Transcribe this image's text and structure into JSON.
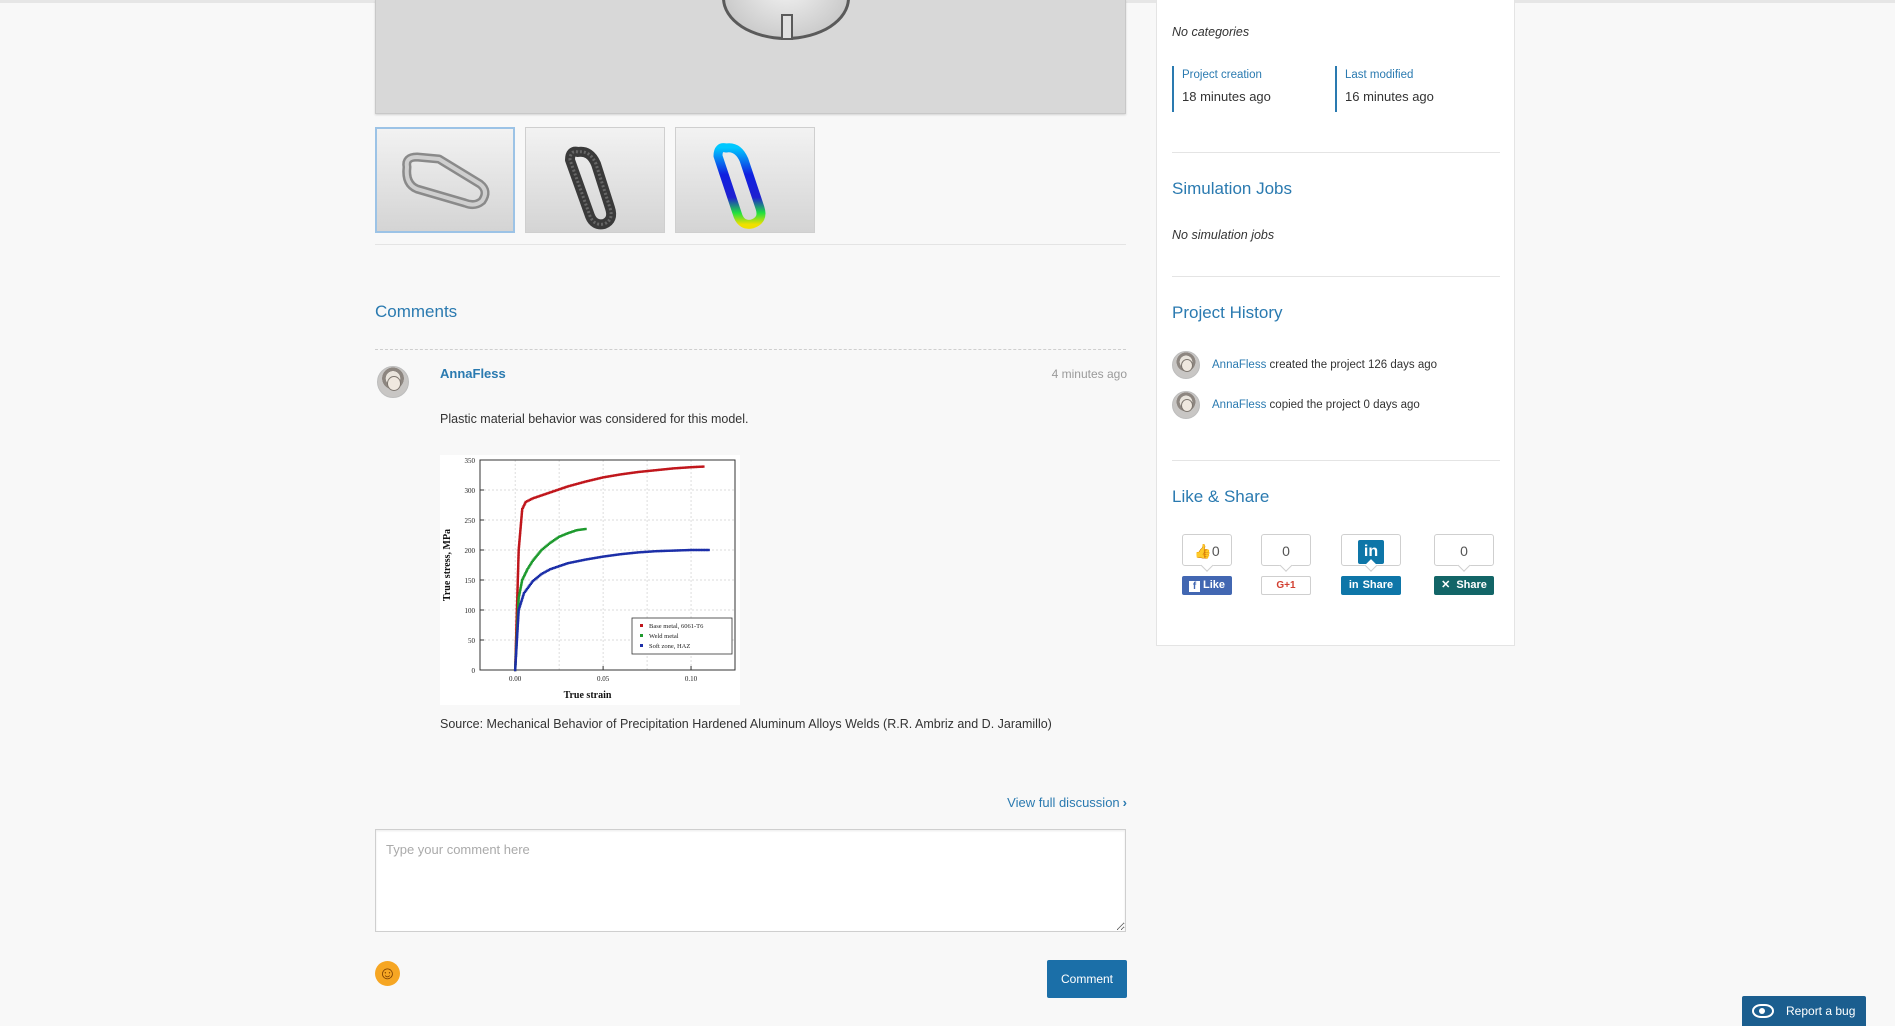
{
  "comments_section": {
    "title": "Comments",
    "comment": {
      "author": "AnnaFless",
      "time": "4 minutes ago",
      "text": "Plastic material behavior was considered for this model.",
      "source": "Source: Mechanical Behavior of Precipitation Hardened Aluminum Alloys Welds (R.R. Ambriz and D. Jaramillo)"
    },
    "view_full_discussion": "View full discussion",
    "comment_placeholder": "Type your comment here",
    "comment_button": "Comment"
  },
  "sidebar": {
    "categories_text": "No categories",
    "project_creation_label": "Project creation",
    "project_creation_value": "18 minutes ago",
    "last_modified_label": "Last modified",
    "last_modified_value": "16 minutes ago",
    "simulation_jobs_title": "Simulation Jobs",
    "simulation_jobs_text": "No simulation jobs",
    "project_history_title": "Project History",
    "history": [
      {
        "user": "AnnaFless",
        "action": "created the project 126 days ago"
      },
      {
        "user": "AnnaFless",
        "action": "copied the project 0 days ago"
      }
    ],
    "like_share_title": "Like & Share",
    "share_buttons": {
      "facebook": {
        "count": "0",
        "label": "Like"
      },
      "google": {
        "count": "0",
        "label": "G+1"
      },
      "linkedin": {
        "label": "Share"
      },
      "xing": {
        "count": "0",
        "label": "Share"
      }
    }
  },
  "report_bug": "Report a bug",
  "chart_data": {
    "type": "scatter",
    "xlabel": "True strain",
    "ylabel": "True stress, MPa",
    "xlim": [
      -0.02,
      0.125
    ],
    "ylim": [
      0,
      350
    ],
    "xticks": [
      "0.00",
      "0.05",
      "0.10"
    ],
    "yticks": [
      "0",
      "50",
      "100",
      "150",
      "200",
      "250",
      "300",
      "350"
    ],
    "legend_position": "lower-right",
    "series": [
      {
        "name": "Base metal, 6061-T6",
        "color": "#c0161c",
        "marker": "square",
        "x": [
          0.0,
          0.002,
          0.004,
          0.006,
          0.01,
          0.02,
          0.03,
          0.04,
          0.05,
          0.06,
          0.07,
          0.08,
          0.09,
          0.1,
          0.107
        ],
        "y": [
          0,
          200,
          268,
          280,
          286,
          296,
          306,
          314,
          321,
          326,
          330,
          333,
          336,
          338,
          339
        ]
      },
      {
        "name": "Weld metal",
        "color": "#1e9a2e",
        "marker": "circle",
        "x": [
          0.0,
          0.002,
          0.004,
          0.007,
          0.01,
          0.015,
          0.02,
          0.025,
          0.03,
          0.035,
          0.04
        ],
        "y": [
          0,
          120,
          150,
          168,
          182,
          200,
          212,
          222,
          228,
          233,
          235
        ]
      },
      {
        "name": "Soft zone, HAZ",
        "color": "#1c2fa8",
        "marker": "triangle",
        "x": [
          0.0,
          0.002,
          0.005,
          0.01,
          0.015,
          0.02,
          0.03,
          0.04,
          0.05,
          0.06,
          0.07,
          0.08,
          0.09,
          0.1,
          0.11
        ],
        "y": [
          0,
          100,
          128,
          148,
          160,
          168,
          178,
          184,
          189,
          193,
          196,
          198,
          199,
          200,
          200
        ]
      }
    ]
  }
}
